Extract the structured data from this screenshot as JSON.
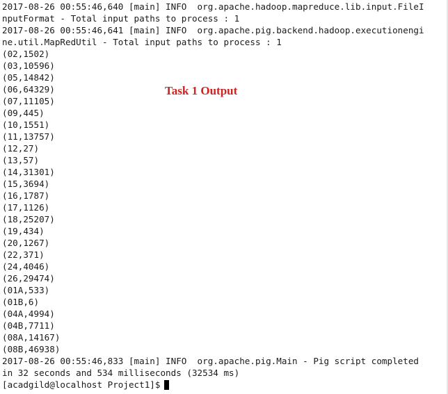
{
  "terminal": {
    "lines": [
      "2017-08-26 00:55:46,640 [main] INFO  org.apache.hadoop.mapreduce.lib.input.FileI",
      "nputFormat - Total input paths to process : 1",
      "2017-08-26 00:55:46,641 [main] INFO  org.apache.pig.backend.hadoop.executionengi",
      "ne.util.MapRedUtil - Total input paths to process : 1",
      "(02,1502)",
      "(03,10596)",
      "(05,14842)",
      "(06,64329)",
      "(07,11105)",
      "(09,445)",
      "(10,1551)",
      "(11,13757)",
      "(12,27)",
      "(13,57)",
      "(14,31301)",
      "(15,3694)",
      "(16,1787)",
      "(17,1126)",
      "(18,25207)",
      "(19,434)",
      "(20,1267)",
      "(22,371)",
      "(24,4046)",
      "(26,29474)",
      "(01A,533)",
      "(01B,6)",
      "(04A,4994)",
      "(04B,7711)",
      "(08A,14167)",
      "(08B,46938)",
      "2017-08-26 00:55:46,833 [main] INFO  org.apache.pig.Main - Pig script completed",
      "in 32 seconds and 534 milliseconds (32534 ms)"
    ],
    "prompt": "[acadgild@localhost Project1]$",
    "cursor_icon": "block-cursor-icon"
  },
  "annotation": {
    "text": "Task 1 Output",
    "color": "#d42020"
  }
}
